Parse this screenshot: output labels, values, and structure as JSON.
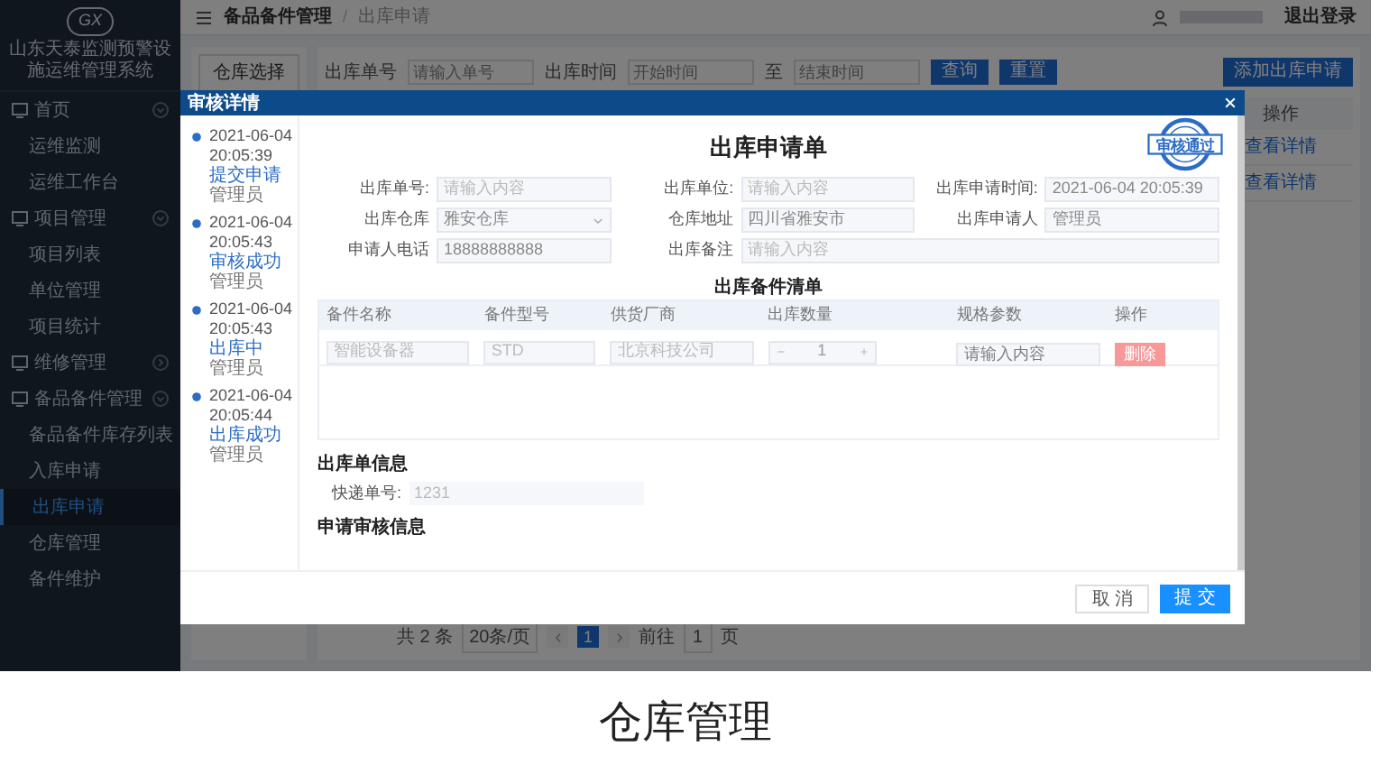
{
  "sidebar": {
    "logo_text": "GX",
    "title": "山东天泰监测预警设施运维管理系统",
    "groups": [
      {
        "label": "首页",
        "expanded": true,
        "children": [
          {
            "label": "运维监测",
            "selected": false
          },
          {
            "label": "运维工作台",
            "selected": false
          }
        ]
      },
      {
        "label": "项目管理",
        "expanded": true,
        "children": [
          {
            "label": "项目列表",
            "selected": false
          },
          {
            "label": "单位管理",
            "selected": false
          },
          {
            "label": "项目统计",
            "selected": false
          }
        ]
      },
      {
        "label": "维修管理",
        "expanded": false
      },
      {
        "label": "备品备件管理",
        "expanded": true,
        "children": [
          {
            "label": "备品备件库存列表",
            "selected": false
          },
          {
            "label": "入库申请",
            "selected": false
          },
          {
            "label": "出库申请",
            "selected": true
          },
          {
            "label": "仓库管理",
            "selected": false
          },
          {
            "label": "备件维护",
            "selected": false
          }
        ]
      }
    ]
  },
  "topbar": {
    "breadcrumb": [
      "备品备件管理",
      "出库申请"
    ],
    "breadcrumb_separator": "/",
    "logout": "退出登录"
  },
  "filter": {
    "tab": "仓库选择",
    "fields": [
      {
        "label": "出库单号",
        "placeholder": "请输入单号"
      },
      {
        "label": "出库时间",
        "placeholder": "开始时间"
      }
    ],
    "separator": "至",
    "end_placeholder": "结束时间",
    "buttons": [
      "查询",
      "重置"
    ]
  },
  "table": {
    "add_button": "添加出库申请",
    "action_header": "操作",
    "row_actions": [
      "查看详情",
      "查看详情"
    ]
  },
  "pagination": {
    "total": "共 2 条",
    "page_size": "20条/页",
    "pages": [
      {
        "label": "1",
        "selected": true
      }
    ],
    "goto_label": "前往",
    "goto_value": "1",
    "goto_suffix": "页"
  },
  "modal": {
    "title": "审核详情",
    "timeline": [
      {
        "date": "2021-06-04",
        "time": "20:05:39",
        "status": "提交申请",
        "user": "管理员"
      },
      {
        "date": "2021-06-04",
        "time": "20:05:43",
        "status": "审核成功",
        "user": "管理员"
      },
      {
        "date": "2021-06-04",
        "time": "20:05:43",
        "status": "出库中",
        "user": "管理员"
      },
      {
        "date": "2021-06-04",
        "time": "20:05:44",
        "status": "出库成功",
        "user": "管理员"
      }
    ],
    "form_title": "出库申请单",
    "stamp": "审核通过",
    "fields": [
      {
        "label": "出库单号:",
        "placeholder": "请输入内容",
        "kind": "input"
      },
      {
        "label": "出库单位:",
        "placeholder": "请输入内容",
        "kind": "input"
      },
      {
        "label": "出库申请时间:",
        "value": "2021-06-04 20:05:39",
        "kind": "input"
      },
      {
        "label": "出库仓库",
        "value": "雅安仓库",
        "kind": "select"
      },
      {
        "label": "仓库地址",
        "value": "四川省雅安市",
        "kind": "input"
      },
      {
        "label": "出库申请人",
        "value": "管理员",
        "kind": "input"
      },
      {
        "label": "申请人电话",
        "value": "18888888888",
        "kind": "input"
      },
      {
        "label": "出库备注",
        "placeholder": "请输入内容",
        "kind": "input"
      }
    ],
    "list_title": "出库备件清单",
    "columns": [
      "备件名称",
      "备件型号",
      "供货厂商",
      "出库数量",
      "规格参数",
      "操作"
    ],
    "rows": [
      {
        "name": "智能设备器",
        "model": "STD",
        "vendor": "北京科技公司",
        "quantity": "1",
        "spec_placeholder": "请输入内容",
        "delete": "删除"
      }
    ],
    "info_title": "出库单信息",
    "express_label": "快递单号:",
    "express_value": "1231",
    "review_title": "申请审核信息",
    "buttons": [
      "取 消",
      "提 交"
    ]
  },
  "caption": "仓库管理"
}
